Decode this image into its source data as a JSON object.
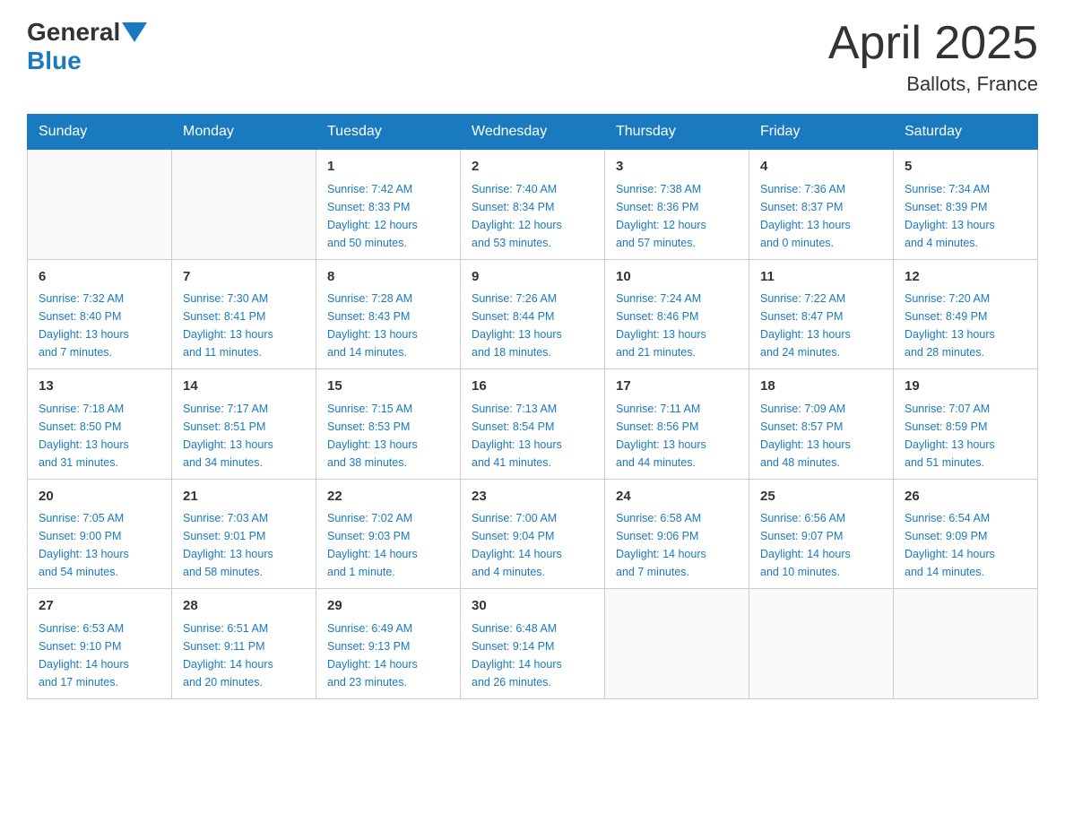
{
  "header": {
    "logo": {
      "general": "General",
      "blue": "Blue"
    },
    "title": "April 2025",
    "location": "Ballots, France"
  },
  "weekdays": [
    "Sunday",
    "Monday",
    "Tuesday",
    "Wednesday",
    "Thursday",
    "Friday",
    "Saturday"
  ],
  "weeks": [
    [
      {
        "day": "",
        "info": ""
      },
      {
        "day": "",
        "info": ""
      },
      {
        "day": "1",
        "info": "Sunrise: 7:42 AM\nSunset: 8:33 PM\nDaylight: 12 hours\nand 50 minutes."
      },
      {
        "day": "2",
        "info": "Sunrise: 7:40 AM\nSunset: 8:34 PM\nDaylight: 12 hours\nand 53 minutes."
      },
      {
        "day": "3",
        "info": "Sunrise: 7:38 AM\nSunset: 8:36 PM\nDaylight: 12 hours\nand 57 minutes."
      },
      {
        "day": "4",
        "info": "Sunrise: 7:36 AM\nSunset: 8:37 PM\nDaylight: 13 hours\nand 0 minutes."
      },
      {
        "day": "5",
        "info": "Sunrise: 7:34 AM\nSunset: 8:39 PM\nDaylight: 13 hours\nand 4 minutes."
      }
    ],
    [
      {
        "day": "6",
        "info": "Sunrise: 7:32 AM\nSunset: 8:40 PM\nDaylight: 13 hours\nand 7 minutes."
      },
      {
        "day": "7",
        "info": "Sunrise: 7:30 AM\nSunset: 8:41 PM\nDaylight: 13 hours\nand 11 minutes."
      },
      {
        "day": "8",
        "info": "Sunrise: 7:28 AM\nSunset: 8:43 PM\nDaylight: 13 hours\nand 14 minutes."
      },
      {
        "day": "9",
        "info": "Sunrise: 7:26 AM\nSunset: 8:44 PM\nDaylight: 13 hours\nand 18 minutes."
      },
      {
        "day": "10",
        "info": "Sunrise: 7:24 AM\nSunset: 8:46 PM\nDaylight: 13 hours\nand 21 minutes."
      },
      {
        "day": "11",
        "info": "Sunrise: 7:22 AM\nSunset: 8:47 PM\nDaylight: 13 hours\nand 24 minutes."
      },
      {
        "day": "12",
        "info": "Sunrise: 7:20 AM\nSunset: 8:49 PM\nDaylight: 13 hours\nand 28 minutes."
      }
    ],
    [
      {
        "day": "13",
        "info": "Sunrise: 7:18 AM\nSunset: 8:50 PM\nDaylight: 13 hours\nand 31 minutes."
      },
      {
        "day": "14",
        "info": "Sunrise: 7:17 AM\nSunset: 8:51 PM\nDaylight: 13 hours\nand 34 minutes."
      },
      {
        "day": "15",
        "info": "Sunrise: 7:15 AM\nSunset: 8:53 PM\nDaylight: 13 hours\nand 38 minutes."
      },
      {
        "day": "16",
        "info": "Sunrise: 7:13 AM\nSunset: 8:54 PM\nDaylight: 13 hours\nand 41 minutes."
      },
      {
        "day": "17",
        "info": "Sunrise: 7:11 AM\nSunset: 8:56 PM\nDaylight: 13 hours\nand 44 minutes."
      },
      {
        "day": "18",
        "info": "Sunrise: 7:09 AM\nSunset: 8:57 PM\nDaylight: 13 hours\nand 48 minutes."
      },
      {
        "day": "19",
        "info": "Sunrise: 7:07 AM\nSunset: 8:59 PM\nDaylight: 13 hours\nand 51 minutes."
      }
    ],
    [
      {
        "day": "20",
        "info": "Sunrise: 7:05 AM\nSunset: 9:00 PM\nDaylight: 13 hours\nand 54 minutes."
      },
      {
        "day": "21",
        "info": "Sunrise: 7:03 AM\nSunset: 9:01 PM\nDaylight: 13 hours\nand 58 minutes."
      },
      {
        "day": "22",
        "info": "Sunrise: 7:02 AM\nSunset: 9:03 PM\nDaylight: 14 hours\nand 1 minute."
      },
      {
        "day": "23",
        "info": "Sunrise: 7:00 AM\nSunset: 9:04 PM\nDaylight: 14 hours\nand 4 minutes."
      },
      {
        "day": "24",
        "info": "Sunrise: 6:58 AM\nSunset: 9:06 PM\nDaylight: 14 hours\nand 7 minutes."
      },
      {
        "day": "25",
        "info": "Sunrise: 6:56 AM\nSunset: 9:07 PM\nDaylight: 14 hours\nand 10 minutes."
      },
      {
        "day": "26",
        "info": "Sunrise: 6:54 AM\nSunset: 9:09 PM\nDaylight: 14 hours\nand 14 minutes."
      }
    ],
    [
      {
        "day": "27",
        "info": "Sunrise: 6:53 AM\nSunset: 9:10 PM\nDaylight: 14 hours\nand 17 minutes."
      },
      {
        "day": "28",
        "info": "Sunrise: 6:51 AM\nSunset: 9:11 PM\nDaylight: 14 hours\nand 20 minutes."
      },
      {
        "day": "29",
        "info": "Sunrise: 6:49 AM\nSunset: 9:13 PM\nDaylight: 14 hours\nand 23 minutes."
      },
      {
        "day": "30",
        "info": "Sunrise: 6:48 AM\nSunset: 9:14 PM\nDaylight: 14 hours\nand 26 minutes."
      },
      {
        "day": "",
        "info": ""
      },
      {
        "day": "",
        "info": ""
      },
      {
        "day": "",
        "info": ""
      }
    ]
  ]
}
